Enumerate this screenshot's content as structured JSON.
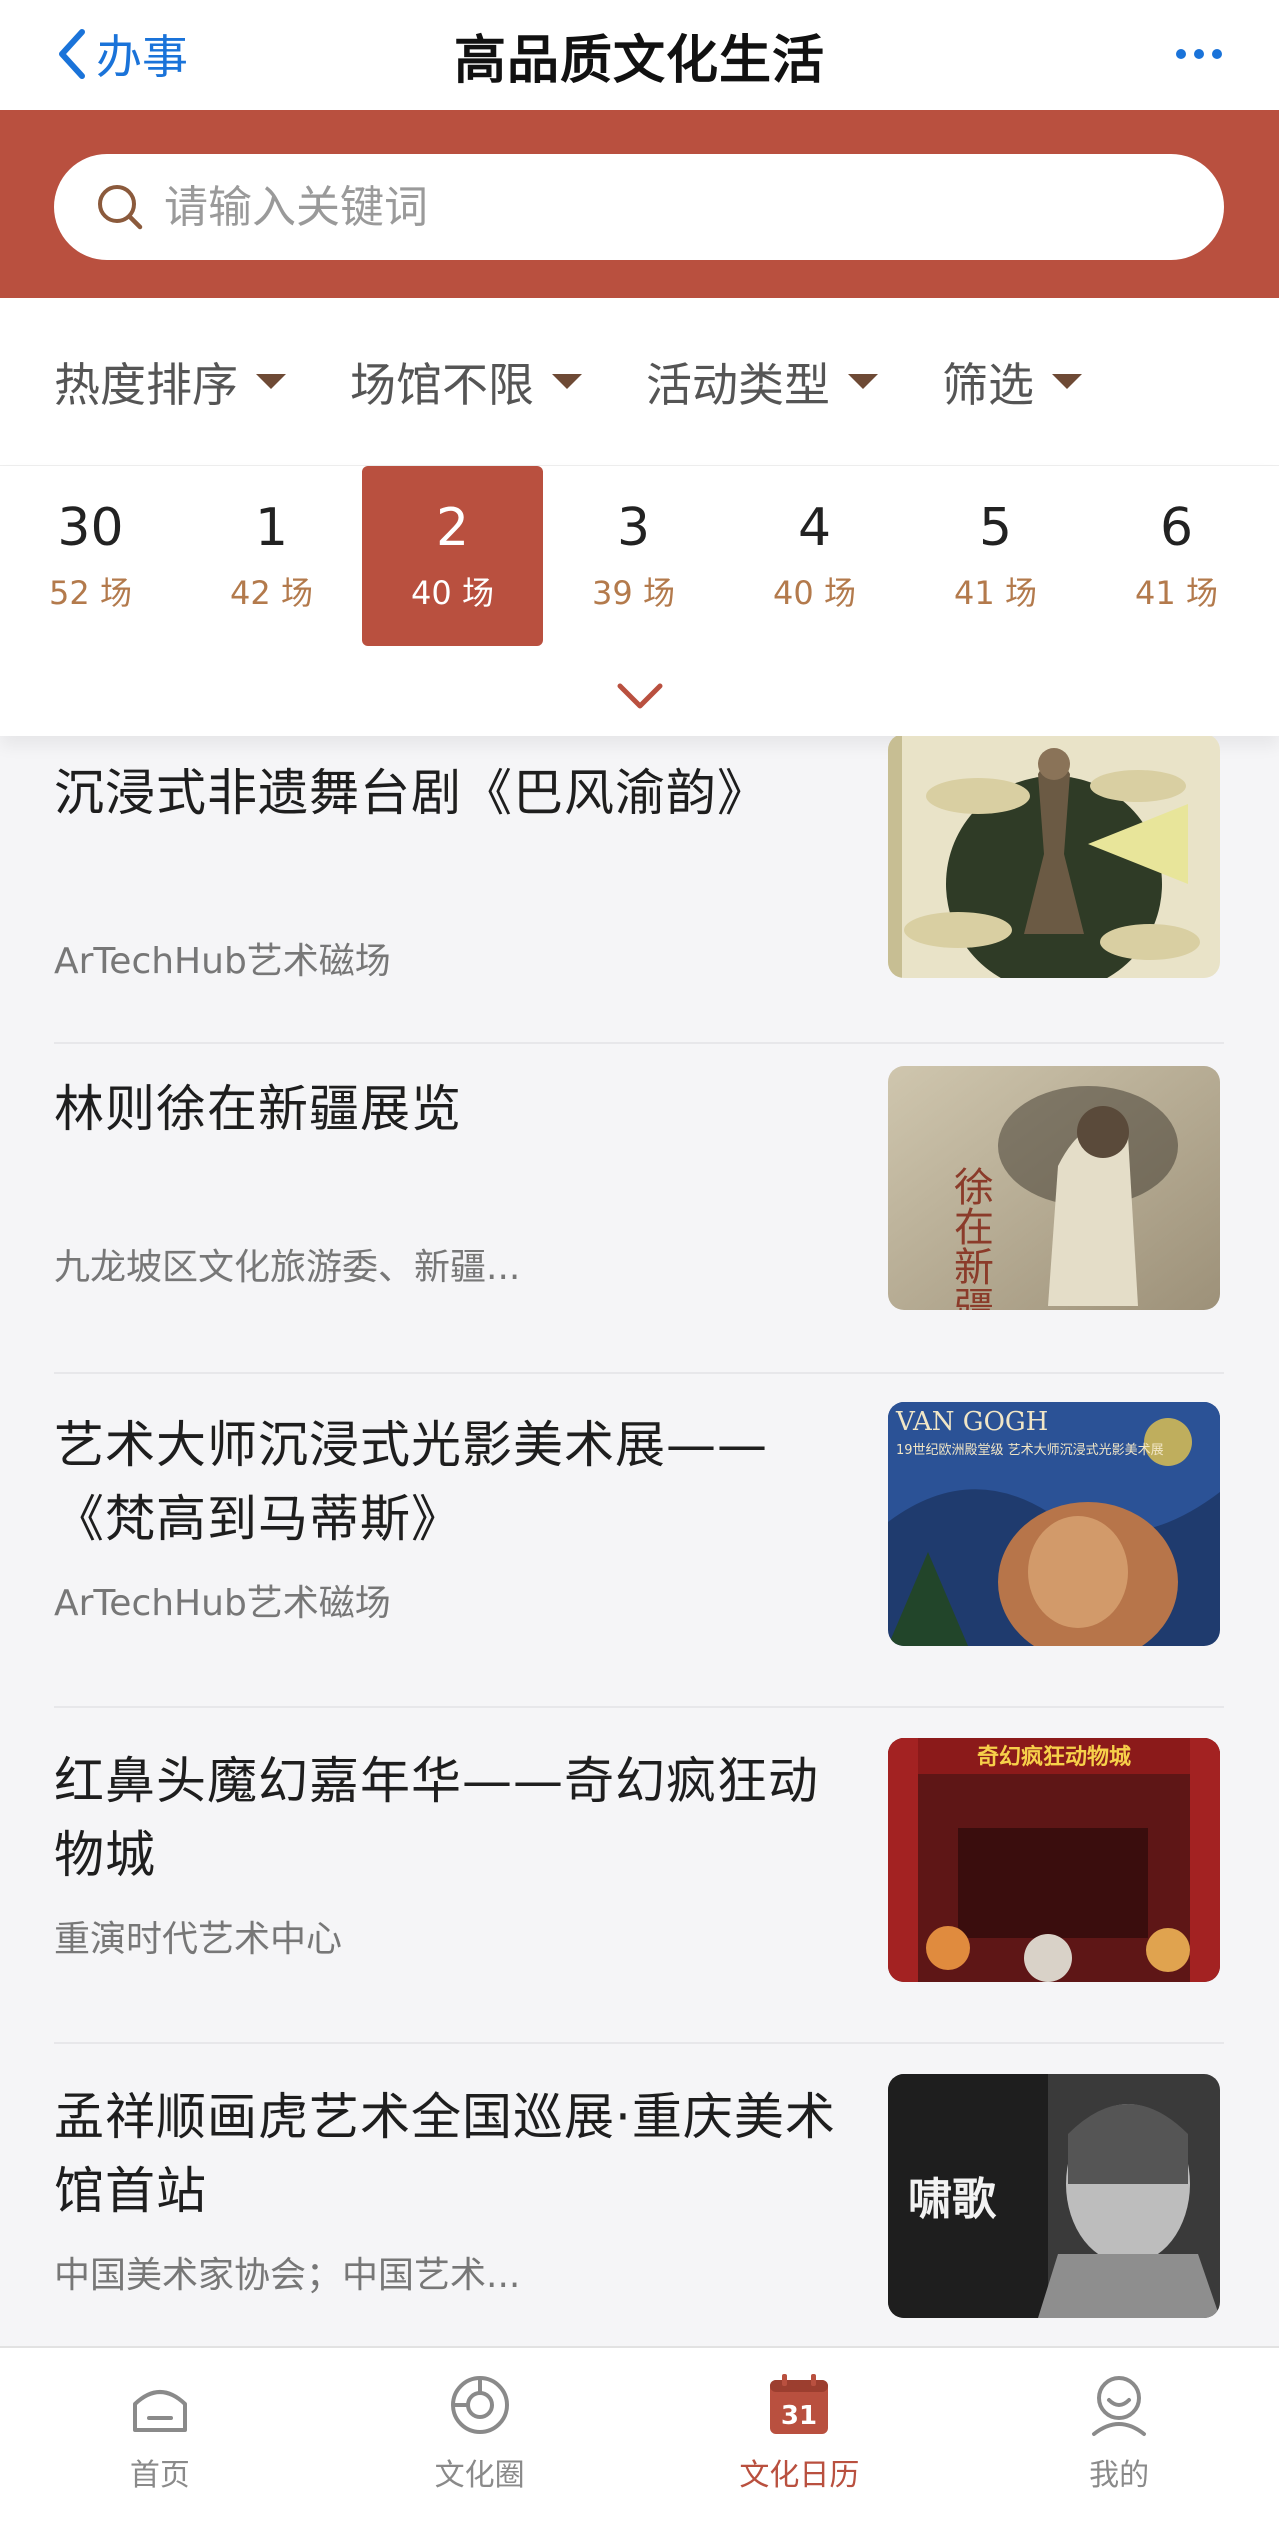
{
  "nav": {
    "back_label": "办事",
    "title": "高品质文化生活",
    "more_icon": "more-dots-icon"
  },
  "search": {
    "placeholder": "请输入关键词",
    "value": ""
  },
  "filters": [
    {
      "label": "热度排序"
    },
    {
      "label": "场馆不限"
    },
    {
      "label": "活动类型"
    },
    {
      "label": "筛选"
    }
  ],
  "dates": [
    {
      "day": "30",
      "count": "52 场",
      "active": false
    },
    {
      "day": "1",
      "count": "42 场",
      "active": false
    },
    {
      "day": "2",
      "count": "40 场",
      "active": true
    },
    {
      "day": "3",
      "count": "39 场",
      "active": false
    },
    {
      "day": "4",
      "count": "40 场",
      "active": false
    },
    {
      "day": "5",
      "count": "41 场",
      "active": false
    },
    {
      "day": "6",
      "count": "41 场",
      "active": false
    }
  ],
  "events": [
    {
      "title": "沉浸式非遗舞台剧《巴风渝韵》",
      "venue": "ArTechHub艺术磁场"
    },
    {
      "title": "林则徐在新疆展览",
      "venue": "九龙坡区文化旅游委、新疆...",
      "thumb_text": "徐在新疆"
    },
    {
      "title": "艺术大师沉浸式光影美术展——《梵高到马蒂斯》",
      "venue": "ArTechHub艺术磁场",
      "thumb_text": "VAN GOGH",
      "thumb_sub": "19世纪欧洲殿堂级 艺术大师沉浸式光影美术展"
    },
    {
      "title": "红鼻头魔幻嘉年华——奇幻疯狂动物城",
      "venue": "重演时代艺术中心",
      "thumb_text": "奇幻疯狂动物城"
    },
    {
      "title": "孟祥顺画虎艺术全国巡展·重庆美术馆首站",
      "venue": "中国美术家协会；中国艺术...",
      "thumb_text": "啸歌"
    }
  ],
  "tabs": [
    {
      "label": "首页",
      "icon": "home-icon",
      "active": false
    },
    {
      "label": "文化圈",
      "icon": "culture-circle-icon",
      "active": false
    },
    {
      "label": "文化日历",
      "icon": "calendar-icon",
      "calendar_day": "31",
      "active": true
    },
    {
      "label": "我的",
      "icon": "profile-icon",
      "active": false
    }
  ],
  "colors": {
    "brand": "#b9503f",
    "link": "#1a73d9",
    "count": "#b37a4c"
  }
}
